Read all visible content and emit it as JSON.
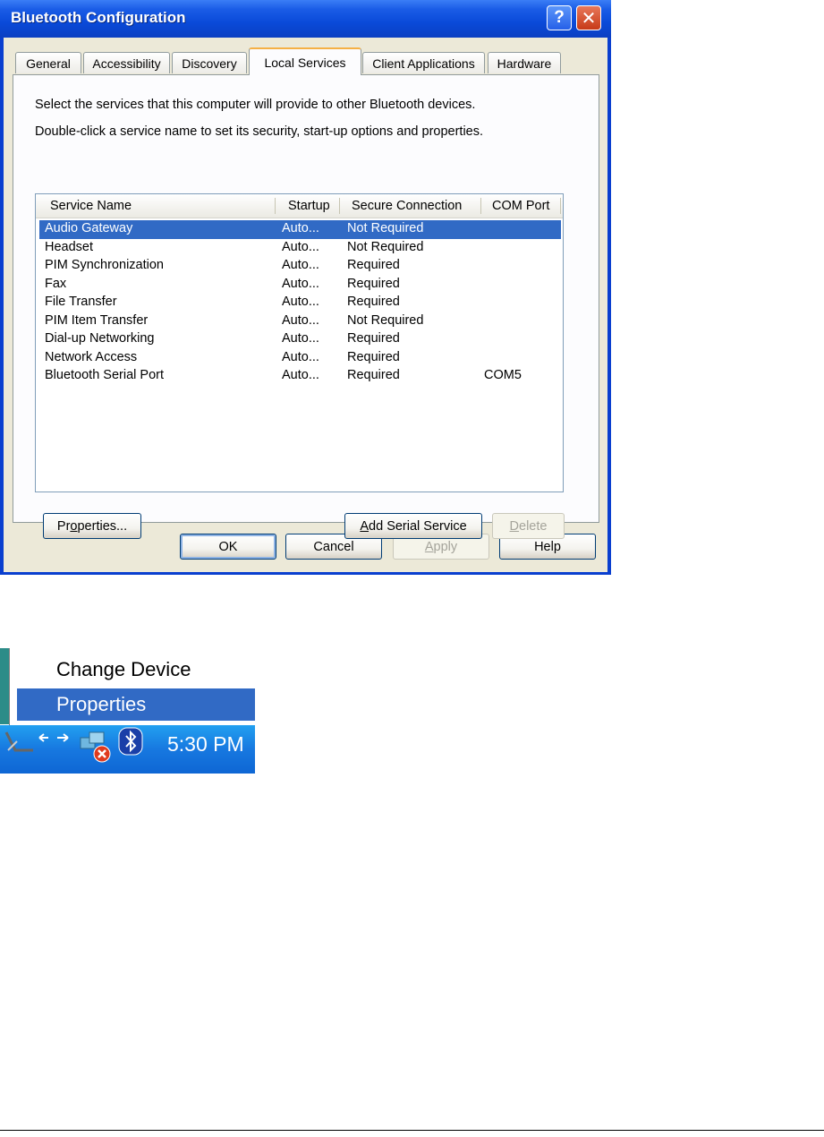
{
  "window": {
    "title": "Bluetooth Configuration",
    "help_glyph": "?",
    "close_glyph": "✕"
  },
  "tabs": [
    {
      "label": "General"
    },
    {
      "label": "Accessibility"
    },
    {
      "label": "Discovery"
    },
    {
      "label": "Local Services",
      "active": true
    },
    {
      "label": "Client Applications"
    },
    {
      "label": "Hardware"
    }
  ],
  "panel": {
    "instruction1": "Select the services that this computer will provide to other Bluetooth devices.",
    "instruction2": "Double-click a service name to set its security, start-up options and properties."
  },
  "list": {
    "columns": [
      "Service Name",
      "Startup",
      "Secure Connection",
      "COM Port"
    ],
    "rows": [
      {
        "name": "Audio Gateway",
        "startup": "Auto...",
        "secure": "Not Required",
        "com": "",
        "selected": true
      },
      {
        "name": "Headset",
        "startup": "Auto...",
        "secure": "Not Required",
        "com": ""
      },
      {
        "name": "PIM Synchronization",
        "startup": "Auto...",
        "secure": "Required",
        "com": ""
      },
      {
        "name": "Fax",
        "startup": "Auto...",
        "secure": "Required",
        "com": ""
      },
      {
        "name": "File Transfer",
        "startup": "Auto...",
        "secure": "Required",
        "com": ""
      },
      {
        "name": "PIM Item Transfer",
        "startup": "Auto...",
        "secure": "Not Required",
        "com": ""
      },
      {
        "name": "Dial-up Networking",
        "startup": "Auto...",
        "secure": "Required",
        "com": ""
      },
      {
        "name": "Network Access",
        "startup": "Auto...",
        "secure": "Required",
        "com": ""
      },
      {
        "name": "Bluetooth Serial Port",
        "startup": "Auto...",
        "secure": "Required",
        "com": "COM5"
      }
    ]
  },
  "buttons": {
    "properties": {
      "pre": "Pr",
      "u": "o",
      "post": "perties..."
    },
    "add_serial": {
      "pre": "",
      "u": "A",
      "post": "dd Serial Service"
    },
    "delete": {
      "pre": "",
      "u": "D",
      "post": "elete"
    },
    "ok": "OK",
    "cancel": "Cancel",
    "apply": {
      "pre": "",
      "u": "A",
      "post": "pply"
    },
    "help": "Help"
  },
  "context_menu": {
    "items": [
      {
        "label": "Change Device"
      },
      {
        "label": "Properties",
        "highlighted": true
      }
    ]
  },
  "taskbar": {
    "clock": "5:30 PM",
    "icons": [
      "resize-grip-icon",
      "network-arrows-icon",
      "network-disconnected-icon",
      "bluetooth-icon"
    ]
  },
  "colors": {
    "title_blue": "#0A4AD9",
    "selection": "#316AC5",
    "dialog_face": "#ECE9D8",
    "tab_accent": "#F5B045"
  }
}
